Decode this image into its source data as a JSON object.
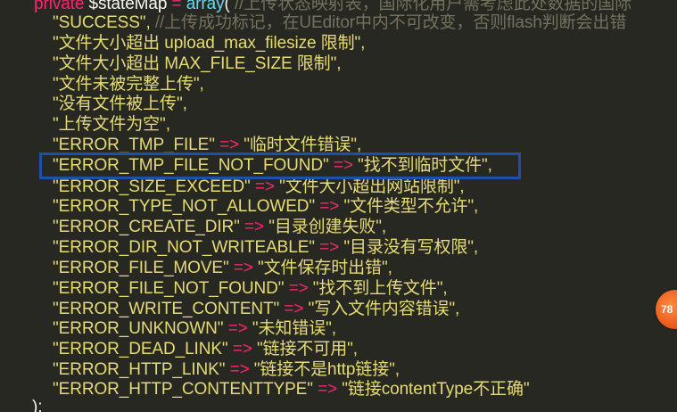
{
  "code": {
    "header": {
      "keyword": "private",
      "variable": "$stateMap",
      "equals": "=",
      "function": "array",
      "paren": "(",
      "comment": "//上传状态映射表，国际化用户需考虑此处数据的国际"
    },
    "success_line": {
      "string": "\"SUCCESS\",",
      "comment": "//上传成功标记，在UEditor中内不可改变，否则flash判断会出错"
    },
    "plain_lines": [
      "\"文件大小超出 upload_max_filesize 限制\",",
      "\"文件大小超出 MAX_FILE_SIZE 限制\",",
      "\"文件未被完整上传\",",
      "\"没有文件被上传\",",
      "\"上传文件为空\","
    ],
    "arrow": "=>",
    "mapped_lines": [
      {
        "key": "\"ERROR_TMP_FILE\"",
        "value": "\"临时文件错误\","
      },
      {
        "key": "\"ERROR_TMP_FILE_NOT_FOUND\"",
        "value": "\"找不到临时文件\","
      },
      {
        "key": "\"ERROR_SIZE_EXCEED\"",
        "value": "\"文件大小超出网站限制\","
      },
      {
        "key": "\"ERROR_TYPE_NOT_ALLOWED\"",
        "value": "\"文件类型不允许\","
      },
      {
        "key": "\"ERROR_CREATE_DIR\"",
        "value": "\"目录创建失败\","
      },
      {
        "key": "\"ERROR_DIR_NOT_WRITEABLE\"",
        "value": "\"目录没有写权限\","
      },
      {
        "key": "\"ERROR_FILE_MOVE\"",
        "value": "\"文件保存时出错\","
      },
      {
        "key": "\"ERROR_FILE_NOT_FOUND\"",
        "value": "\"找不到上传文件\","
      },
      {
        "key": "\"ERROR_WRITE_CONTENT\"",
        "value": "\"写入文件内容错误\","
      },
      {
        "key": "\"ERROR_UNKNOWN\"",
        "value": "\"未知错误\","
      },
      {
        "key": "\"ERROR_DEAD_LINK\"",
        "value": "\"链接不可用\","
      },
      {
        "key": "\"ERROR_HTTP_LINK\"",
        "value": "\"链接不是http链接\","
      },
      {
        "key": "\"ERROR_HTTP_CONTENTTYPE\"",
        "value": "\"链接contentType不正确\""
      }
    ],
    "closing": ");"
  },
  "badge": {
    "text": "78"
  },
  "colors": {
    "background": "#272822",
    "keyword": "#f92672",
    "function": "#66d9ef",
    "string": "#e6db74",
    "comment": "#75715e",
    "highlight_border": "#1f4fa8",
    "badge": "#e8551a"
  }
}
